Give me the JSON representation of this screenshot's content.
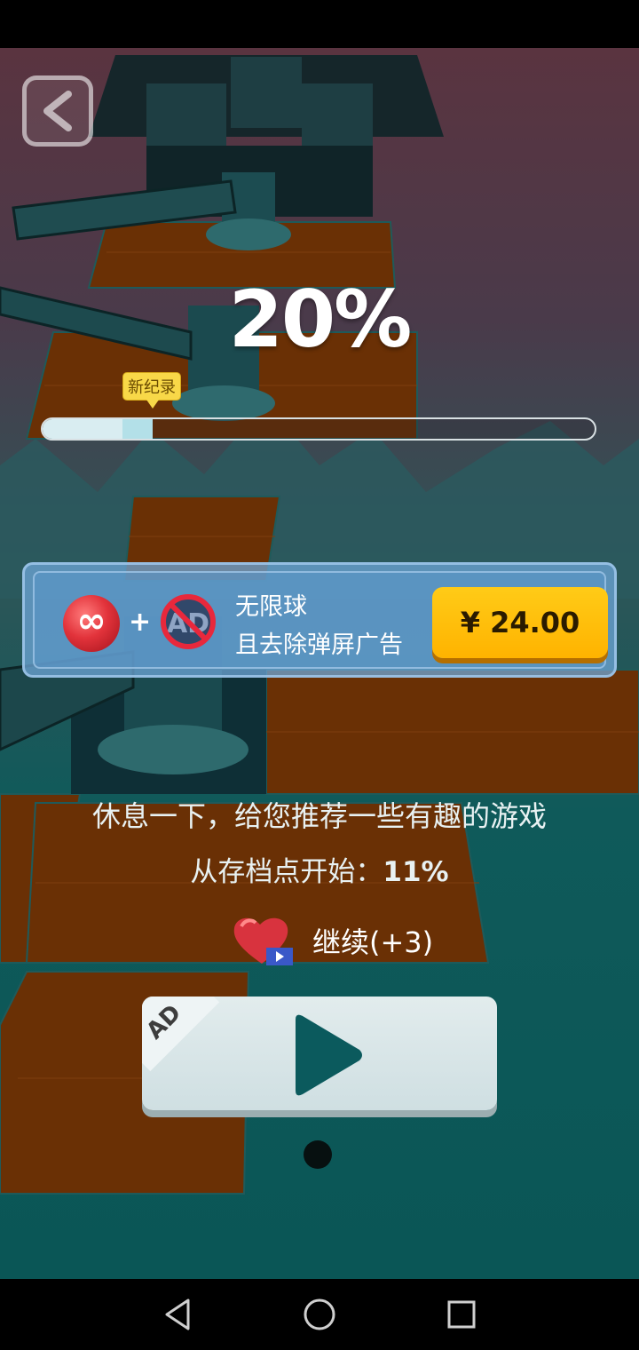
{
  "progress": {
    "percent_label": "20%",
    "fill_fraction": 0.2,
    "record_fraction": 0.2,
    "record_tag": "新纪录"
  },
  "offer": {
    "infinite_symbol": "∞",
    "plus": "+",
    "title": "无限球",
    "subtitle": "且去除弹屏广告",
    "price": "¥ 24.00"
  },
  "rest": {
    "message": "休息一下，给您推荐一些有趣的游戏",
    "checkpoint_label": "从存档点开始：",
    "checkpoint_value": "11%"
  },
  "continue": {
    "label": "继续(+3)"
  },
  "play_button": {
    "ad_badge": "AD"
  },
  "icons": [
    "back-arrow-icon",
    "infinite-ball-icon",
    "no-ads-icon",
    "heart-icon",
    "video-ad-icon",
    "play-icon",
    "nav-back-icon",
    "nav-home-icon",
    "nav-recents-icon"
  ]
}
